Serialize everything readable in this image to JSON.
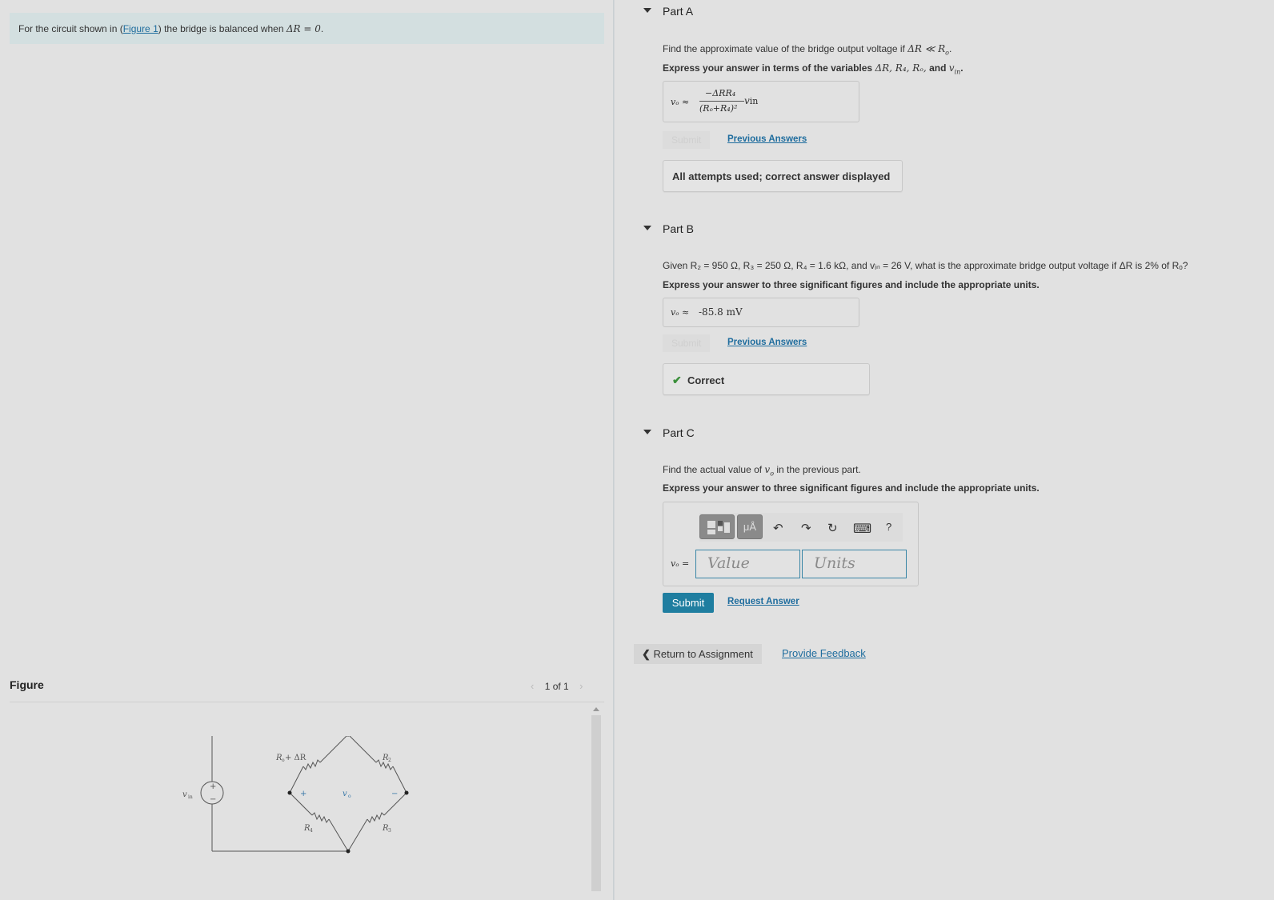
{
  "intro": {
    "prefix": "For the circuit shown in (",
    "figure_link": "Figure 1",
    "suffix": ") the bridge is balanced when ",
    "math": "ΔR = 0",
    "end": "."
  },
  "figure": {
    "title": "Figure",
    "pager": "1 of 1",
    "labels": {
      "vin": "v",
      "vin_sub": "in",
      "ro_dr": "R",
      "ro_dr_sub": "o",
      "ro_dr_tail": " + ΔR",
      "r2": "R",
      "r2_sub": "2",
      "r3": "R",
      "r3_sub": "3",
      "r4": "R",
      "r4_sub": "4",
      "vo": "v",
      "vo_sub": "o",
      "plus": "+",
      "minus": "−"
    }
  },
  "partA": {
    "label": "Part A",
    "question_prefix": "Find the approximate value of the bridge output voltage if ",
    "question_math": "ΔR ≪ R",
    "question_math_sub": "o",
    "question_end": ".",
    "instruction_prefix": "Express your answer in terms of the variables ",
    "instruction_vars": "ΔR, R₄, Rₒ,",
    "instruction_and": " and ",
    "instruction_last": "v",
    "instruction_last_sub": "in",
    "instruction_end": ".",
    "answer_lhs": "vₒ ≈",
    "answer_num": "−ΔRR₄",
    "answer_den": "(Rₒ+R₄)²",
    "answer_tail": "v",
    "answer_tail_sub": "in",
    "submit_label": "Submit",
    "prev_answers": "Previous Answers",
    "status": "All attempts used; correct answer displayed"
  },
  "partB": {
    "label": "Part B",
    "question": "Given R₂ = 950 Ω, R₃ = 250 Ω, R₄ = 1.6 kΩ, and vᵢₙ = 26 V, what is the approximate bridge output voltage if ΔR is 2% of Rₒ?",
    "instruction": "Express your answer to three significant figures and include the appropriate units.",
    "answer_lhs": "vₒ ≈",
    "answer_value": "-85.8 mV",
    "submit_label": "Submit",
    "prev_answers": "Previous Answers",
    "status": "Correct"
  },
  "partC": {
    "label": "Part C",
    "question_prefix": "Find the actual value of ",
    "question_var": "v",
    "question_var_sub": "o",
    "question_suffix": " in the previous part.",
    "instruction": "Express your answer to three significant figures and include the appropriate units.",
    "toolbar": {
      "templates_icon": "fraction-template-icon",
      "units_label": "μÅ",
      "undo_icon": "↶",
      "redo_icon": "↷",
      "reset_icon": "↻",
      "keyboard_icon": "⌨",
      "help_label": "?"
    },
    "answer_lhs": "vₒ =",
    "value_placeholder": "Value",
    "units_placeholder": "Units",
    "submit_label": "Submit",
    "request_answer": "Request Answer"
  },
  "footer": {
    "return_label": "Return to Assignment",
    "feedback_label": "Provide Feedback"
  }
}
